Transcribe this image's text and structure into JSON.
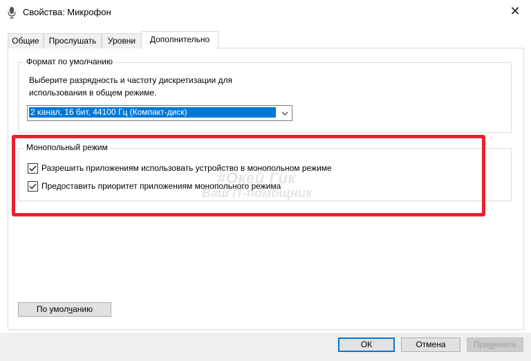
{
  "window": {
    "title": "Свойства: Микрофон",
    "icon": "microphone-icon",
    "close_glyph": "✕"
  },
  "tabs": [
    {
      "label": "Общие",
      "active": false
    },
    {
      "label": "Прослушать",
      "active": false
    },
    {
      "label": "Уровни",
      "active": false
    },
    {
      "label": "Дополнительно",
      "active": true
    }
  ],
  "default_format": {
    "legend": "Формат по умолчанию",
    "description_line1": "Выберите разрядность и частоту дискретизации для",
    "description_line2": "использования в общем режиме.",
    "selected_value": "2 канал, 16 бит, 44100 Гц (Компакт-диск)"
  },
  "exclusive_mode": {
    "legend": "Монопольный режим",
    "options": [
      {
        "label": "Разрешить приложениям использовать устройство в монопольном режиме",
        "checked": true
      },
      {
        "label": "Предоставить приоритет приложениям монопольного режима",
        "checked": true
      }
    ]
  },
  "watermark": {
    "line1": "#Окей Гик",
    "line2": "Ваш IT-помощник"
  },
  "buttons": {
    "defaults_pre": "По умол",
    "defaults_ul": "ч",
    "defaults_post": "анию",
    "ok": "ОК",
    "cancel": "Отмена",
    "apply_pre": "При",
    "apply_ul": "м",
    "apply_post": "енить"
  },
  "colors": {
    "highlight": "#e8212e",
    "selection": "#0078d7"
  }
}
